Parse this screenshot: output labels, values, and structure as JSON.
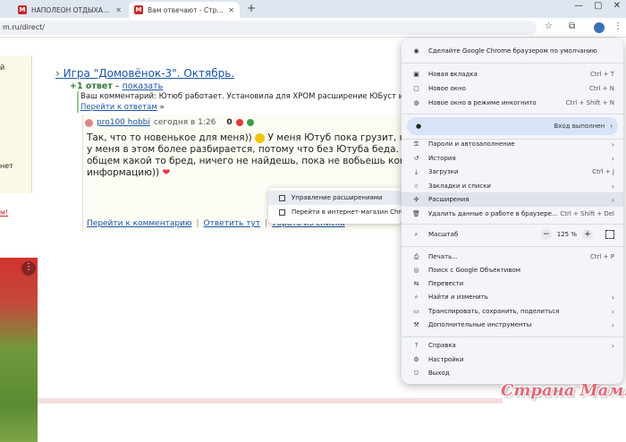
{
  "tabs": [
    {
      "title": "НАПОЛЕОН ОТДЫХАЕТ - мас",
      "favicon": "М"
    },
    {
      "title": "Вам отвечают - Страна Мам",
      "favicon": "М"
    }
  ],
  "address": "m.ru/direct/",
  "profile_avatar": "",
  "page": {
    "left_texts": [
      "й",
      "нет"
    ],
    "left_link": "м!",
    "game_link": "Игра \"Домовёнок-3\". Октябрь.",
    "answers_count": "+1 ответ",
    "answers_sep": " – ",
    "answers_show": "показать",
    "my_comment": "Ваш комментарий: Ютюб работает. Установила для ХРОМ расширение ЮБуст и всё ОК. Пошл",
    "go_to_answers": "Перейти к ответам",
    "go_to_answers_arrow": "»",
    "reply": {
      "user": "pro100 hobbi",
      "date": "сегодня в 1:26",
      "rating": "0",
      "lines": [
        "Так, что то новенькое для меня))",
        "У меня Ютуб пока грузит, но уже не так к",
        "у меня в этом более разбирается, потому что без Ютуба беда. Пробовала на н",
        "общем какой то бред, ничего не найдешь, пока не вобьешь конкретную информ",
        "информацию))"
      ],
      "link_comment": "Перейти к комментарию",
      "link_reply": "Ответить тут",
      "link_remove": "Убрать из списка"
    }
  },
  "submenu": {
    "items": [
      "Управление расширениями",
      "Перейти в интернет-магазин Chrome"
    ]
  },
  "menu": {
    "default_browser": "Сделайте Google Chrome браузером по умолчанию",
    "new_tab": "Новая вкладка",
    "new_tab_sc": "Ctrl + T",
    "new_window": "Новое окно",
    "new_window_sc": "Ctrl + N",
    "incognito": "Новое окно в режиме инкогнито",
    "incognito_sc": "Ctrl + Shift + N",
    "signed_in": "Вход выполнен",
    "passwords": "Пароли и автозаполнение",
    "history": "История",
    "downloads": "Загрузки",
    "downloads_sc": "Ctrl + J",
    "bookmarks": "Закладки и списки",
    "extensions": "Расширения",
    "clear_data": "Удалить данные о работе в браузере...",
    "clear_data_sc": "Ctrl + Shift + Del",
    "zoom": "Масштаб",
    "zoom_value": "125 %",
    "print": "Печать...",
    "print_sc": "Ctrl + P",
    "lens": "Поиск с Google Объективом",
    "translate": "Перевести",
    "find": "Найти и изменить",
    "cast": "Транслировать, сохранить, поделиться",
    "more_tools": "Дополнительные инструменты",
    "help": "Справка",
    "settings": "Настройки",
    "exit": "Выход"
  },
  "watermark": "Страна Мам."
}
